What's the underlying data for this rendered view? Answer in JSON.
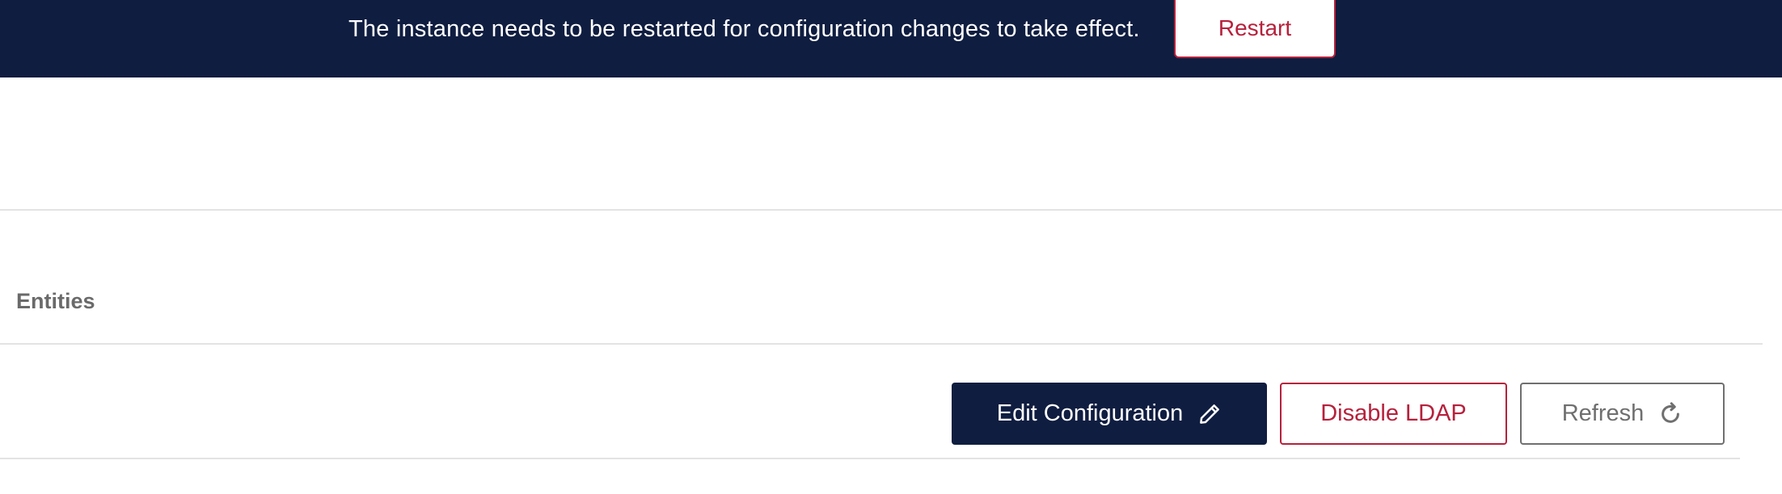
{
  "banner": {
    "message": "The instance needs to be restarted for configuration changes to take effect.",
    "restart_label": "Restart"
  },
  "section": {
    "title": "Entities"
  },
  "actions": {
    "edit_label": "Edit Configuration",
    "edit_icon": "pencil-icon",
    "disable_label": "Disable LDAP",
    "refresh_label": "Refresh",
    "refresh_icon": "refresh-icon"
  },
  "colors": {
    "navy": "#0f1d40",
    "accent_red": "#b6213c",
    "neutral_gray": "#6f6f6f",
    "divider": "#e3e3e3"
  }
}
